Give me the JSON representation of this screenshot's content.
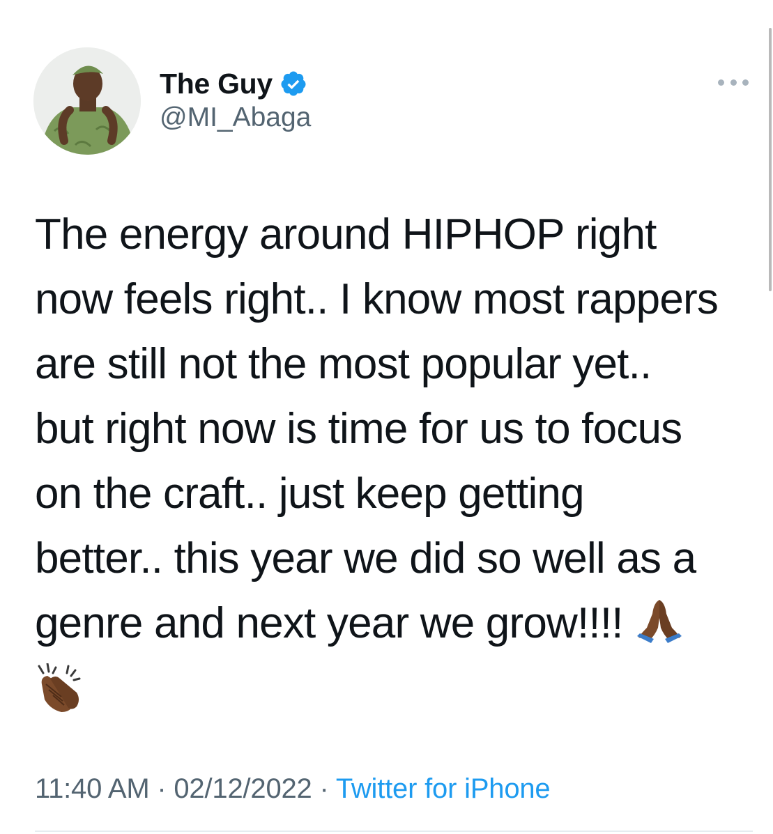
{
  "author": {
    "display_name": "The Guy",
    "handle": "@MI_Abaga",
    "verified": true,
    "verified_icon": "verified-badge-icon",
    "avatar_icon": "avatar-photo"
  },
  "tweet": {
    "text_lines": [
      "The energy around HIPHOP right",
      "now feels right.. I know most rappers",
      "are still not the most popular yet..",
      "but right now is time for us to focus",
      "on the craft.. just keep getting",
      "better.. this year we did so well as a",
      "genre and next year we grow!!!!"
    ],
    "emojis": [
      "folded-hands-emoji",
      "clapping-hands-emoji"
    ]
  },
  "meta": {
    "time": "11:40 AM",
    "separator": " · ",
    "date": "02/12/2022",
    "source": "Twitter for iPhone"
  },
  "menu": {
    "icon": "more-options-icon"
  },
  "colors": {
    "text": "#0f1419",
    "secondary": "#536471",
    "link": "#1d9bf0",
    "verified": "#1d9bf0",
    "divider": "#e6ecf0"
  }
}
